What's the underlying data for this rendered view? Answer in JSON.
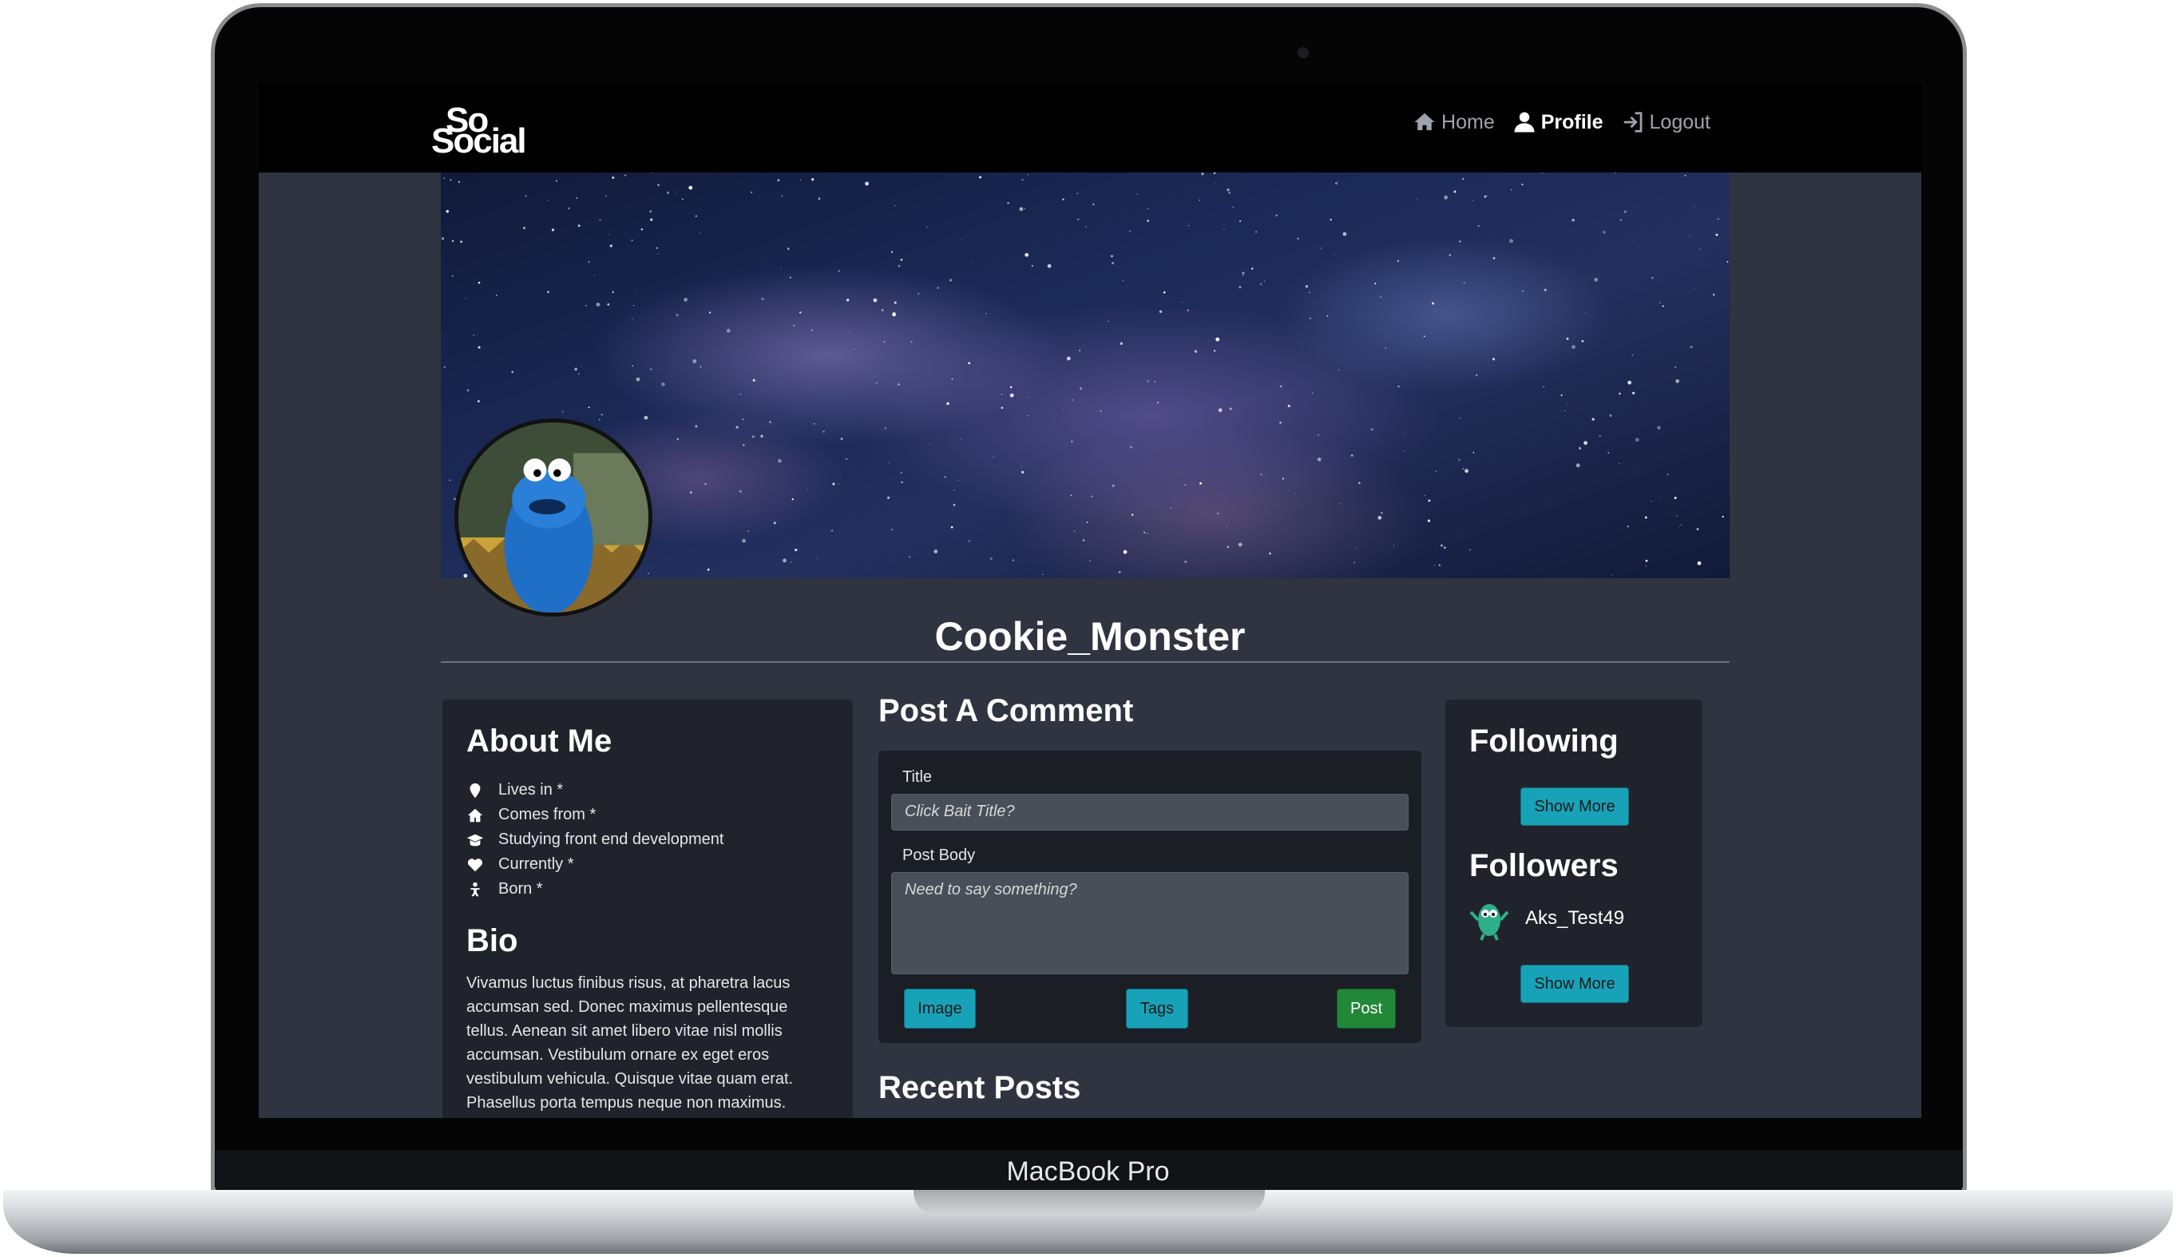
{
  "device": {
    "label": "MacBook Pro"
  },
  "nav": {
    "logo_line1": "So",
    "logo_line2": "Social",
    "links": [
      {
        "label": "Home",
        "icon": "home-icon"
      },
      {
        "label": "Profile",
        "icon": "person-icon",
        "active": true
      },
      {
        "label": "Logout",
        "icon": "logout-icon"
      }
    ]
  },
  "profile": {
    "username": "Cookie_Monster"
  },
  "about": {
    "title": "About Me",
    "items": [
      {
        "icon": "map-pin-icon",
        "text": "Lives in *"
      },
      {
        "icon": "house-icon",
        "text": "Comes from *"
      },
      {
        "icon": "graduation-cap-icon",
        "text": "Studying front end development"
      },
      {
        "icon": "heart-icon",
        "text": "Currently *"
      },
      {
        "icon": "baby-icon",
        "text": "Born *"
      }
    ],
    "bio_title": "Bio",
    "bio_text": "Vivamus luctus finibus risus, at pharetra lacus accumsan sed. Donec maximus pellentesque tellus. Aenean sit amet libero vitae nisl mollis accumsan. Vestibulum ornare ex eget eros vestibulum vehicula. Quisque vitae quam erat. Phasellus porta tempus neque non maximus."
  },
  "post": {
    "title": "Post A Comment",
    "title_label": "Title",
    "title_placeholder": "Click Bait Title?",
    "body_label": "Post Body",
    "body_placeholder": "Need to say something?",
    "image_button": "Image",
    "tags_button": "Tags",
    "post_button": "Post"
  },
  "recent": {
    "title": "Recent Posts"
  },
  "follow": {
    "following_title": "Following",
    "followers_title": "Followers",
    "show_more": "Show More",
    "followers": [
      {
        "name": "Aks_Test49"
      }
    ]
  },
  "colors": {
    "page_bg": "#2f3440",
    "card_bg": "#20232b",
    "info_button": "#17a2b8",
    "success_button": "#218838",
    "navbar": "#000000"
  }
}
